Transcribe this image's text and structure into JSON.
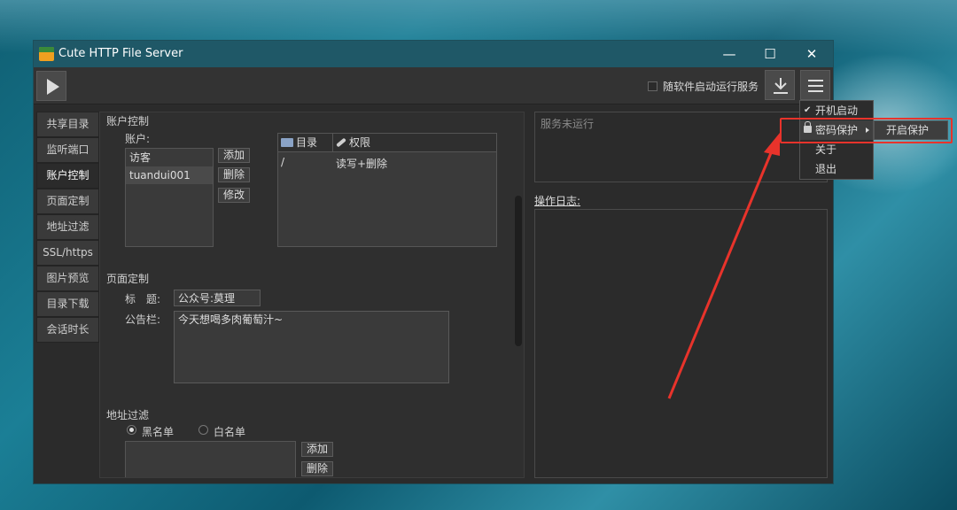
{
  "window": {
    "title": "Cute HTTP File Server",
    "min_glyph": "—",
    "max_glyph": "☐",
    "close_glyph": "✕"
  },
  "toolbar": {
    "autostart_label": "随软件启动运行服务"
  },
  "tabs": [
    "共享目录",
    "监听端口",
    "账户控制",
    "页面定制",
    "地址过滤",
    "SSL/https",
    "图片预览",
    "目录下载",
    "会话时长"
  ],
  "active_tab": "账户控制",
  "account": {
    "section_title": "账户控制",
    "users_label": "账户:",
    "users": [
      "访客",
      "tuandui001"
    ],
    "add_label": "添加",
    "delete_label": "删除",
    "edit_label": "修改",
    "perm_headers": [
      "目录",
      "权限"
    ],
    "perm_rows": [
      {
        "dir": "/",
        "perm": "读写+删除"
      }
    ]
  },
  "page_custom": {
    "section_title": "页面定制",
    "title_label": "标　题:",
    "title_value": "公众号:莫理",
    "notice_label": "公告栏:",
    "notice_value": "今天想喝多肉葡萄汁~"
  },
  "addr_filter": {
    "section_title": "地址过滤",
    "blacklist_label": "黑名单",
    "whitelist_label": "白名单",
    "add_label": "添加",
    "delete_label": "删除"
  },
  "status": {
    "text": "服务未运行",
    "log_label": "操作日志:"
  },
  "menu": {
    "items": [
      {
        "label": "开机启动",
        "checked": true
      },
      {
        "label": "密码保护",
        "submenu": true
      },
      {
        "label": "关于"
      },
      {
        "label": "退出"
      }
    ],
    "check_glyph": "✔",
    "submenu_item": "开启保护"
  },
  "colors": {
    "highlight": "#e8332b",
    "window_bg": "#2b2b2b",
    "titlebar": "#1f5867"
  }
}
